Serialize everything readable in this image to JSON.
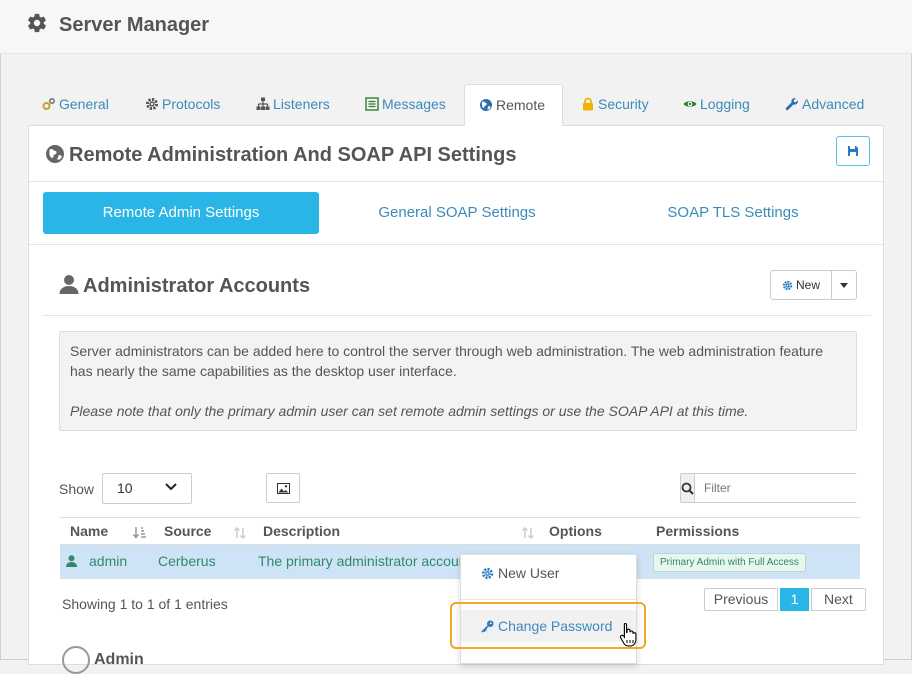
{
  "app": {
    "title": "Server Manager"
  },
  "tabs": [
    {
      "label": "General",
      "icon": "cogs-icon"
    },
    {
      "label": "Protocols",
      "icon": "gear-icon"
    },
    {
      "label": "Listeners",
      "icon": "sitemap-icon"
    },
    {
      "label": "Messages",
      "icon": "list-icon"
    },
    {
      "label": "Remote",
      "icon": "globe-icon",
      "active": true
    },
    {
      "label": "Security",
      "icon": "lock-icon"
    },
    {
      "label": "Logging",
      "icon": "eye-icon"
    },
    {
      "label": "Advanced",
      "icon": "wrench-icon"
    }
  ],
  "page": {
    "title": "Remote Administration And SOAP API Settings"
  },
  "subtabs": [
    {
      "label": "Remote Admin Settings",
      "active": true
    },
    {
      "label": "General SOAP Settings"
    },
    {
      "label": "SOAP TLS Settings"
    }
  ],
  "section": {
    "title": "Administrator Accounts",
    "new_label": "New"
  },
  "info": {
    "text": "Server administrators can be added here to control the server through web administration. The web administration feature has nearly the same capabilities as the desktop user interface.",
    "note": "Please note that only the primary admin user can set remote admin settings or use the SOAP API at this time."
  },
  "table_controls": {
    "show_label": "Show",
    "page_size": "10",
    "filter_placeholder": "Filter"
  },
  "table": {
    "columns": [
      "Name",
      "Source",
      "Description",
      "Options",
      "Permissions"
    ],
    "rows": [
      {
        "name": "admin",
        "source": "Cerberus",
        "description": "The primary administrator account",
        "permissions": "Primary Admin with Full Access"
      }
    ]
  },
  "footer": {
    "entries": "Showing 1 to 1 of 1 entries",
    "prev": "Previous",
    "page": "1",
    "next": "Next"
  },
  "detail": {
    "label": "Admin"
  },
  "menu": {
    "items": [
      {
        "label": "New User",
        "icon": "gear-icon"
      },
      {
        "label": "Change Password",
        "icon": "key-icon"
      }
    ]
  },
  "colors": {
    "accent": "#29b6e6",
    "link": "#3a8bb8",
    "row_highlight": "#cfe3f7",
    "focus_outline": "#f5a623",
    "text_green": "#2e8a6d"
  }
}
